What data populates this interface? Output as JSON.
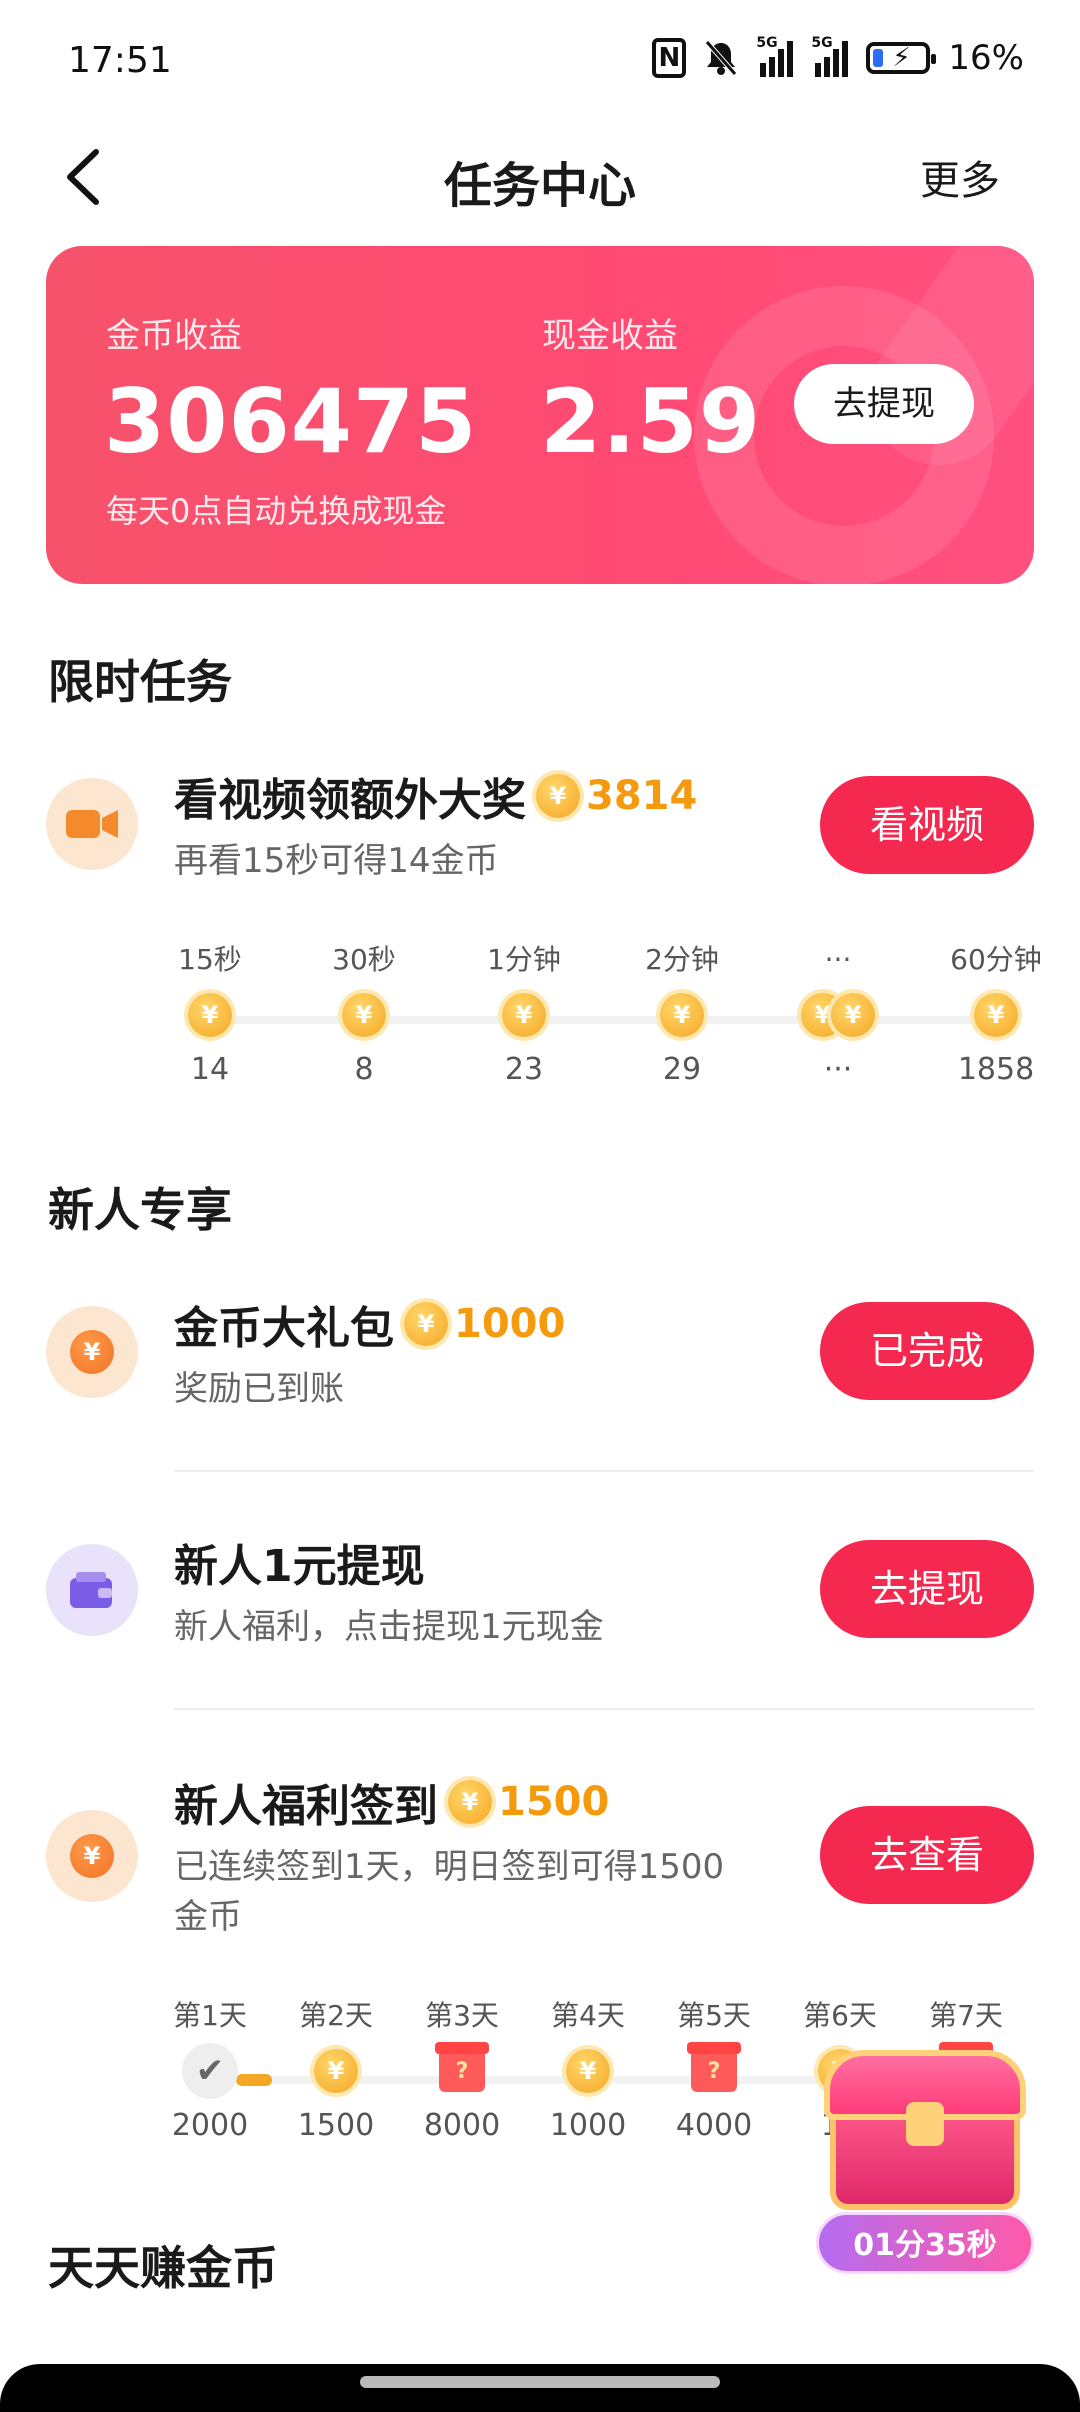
{
  "status_bar": {
    "time": "17:51",
    "signal_label": "5G",
    "battery": "16%"
  },
  "header": {
    "title": "任务中心",
    "more": "更多"
  },
  "earnings": {
    "coin_label": "金币收益",
    "coin_value": "306475",
    "cash_label": "现金收益",
    "cash_value": "2.59",
    "withdraw_button": "去提现",
    "note": "每天0点自动兑换成现金"
  },
  "limited": {
    "section_title": "限时任务",
    "task": {
      "title": "看视频领额外大奖",
      "reward": "3814",
      "subtitle": "再看15秒可得14金币",
      "button": "看视频"
    },
    "timeline": [
      {
        "time": "15秒",
        "coins": "14"
      },
      {
        "time": "30秒",
        "coins": "8"
      },
      {
        "time": "1分钟",
        "coins": "23"
      },
      {
        "time": "2分钟",
        "coins": "29"
      },
      {
        "time": "···",
        "coins": "···"
      },
      {
        "time": "60分钟",
        "coins": "1858"
      }
    ]
  },
  "newbie": {
    "section_title": "新人专享",
    "tasks": [
      {
        "title": "金币大礼包",
        "reward": "1000",
        "subtitle": "奖励已到账",
        "button": "已完成"
      },
      {
        "title": "新人1元提现",
        "subtitle": "新人福利，点击提现1元现金",
        "button": "去提现"
      },
      {
        "title": "新人福利签到",
        "reward": "1500",
        "subtitle_line1": "已连续签到1天，明日签到可得1500",
        "subtitle_line2": "金币",
        "button": "去查看"
      }
    ],
    "checkin": [
      {
        "day": "第1天",
        "coins": "2000"
      },
      {
        "day": "第2天",
        "coins": "1500"
      },
      {
        "day": "第3天",
        "coins": "8000"
      },
      {
        "day": "第4天",
        "coins": "1000"
      },
      {
        "day": "第5天",
        "coins": "4000"
      },
      {
        "day": "第6天",
        "coins": "15"
      },
      {
        "day": "第7天",
        "coins": ""
      }
    ]
  },
  "daily": {
    "section_title": "天天赚金币"
  },
  "floating": {
    "timer": "01分35秒"
  },
  "icons": {
    "coin_symbol": "¥",
    "gift_symbol": "?",
    "check_symbol": "✔"
  },
  "colors": {
    "accent": "#f5284f",
    "card_gradient_start": "#f6526b",
    "card_gradient_end": "#ff5080",
    "reward_orange": "#f59a0c"
  }
}
